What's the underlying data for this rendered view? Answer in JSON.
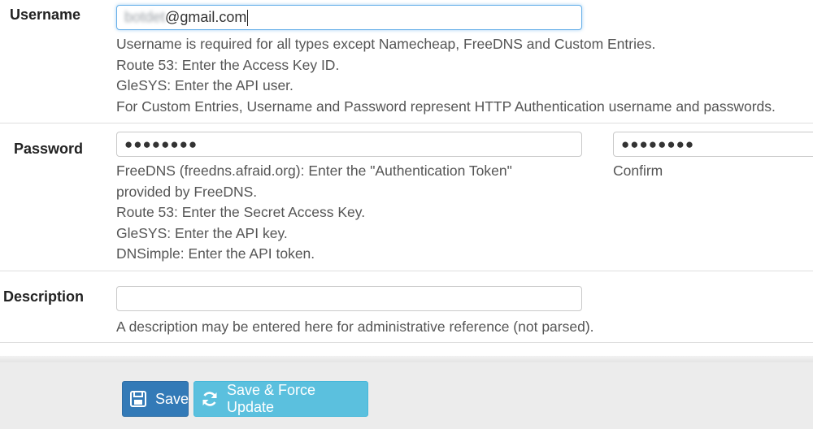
{
  "username": {
    "label": "Username",
    "value_blurred": "botdet",
    "value_suffix": "@gmail.com",
    "help": [
      "Username is required for all types except Namecheap, FreeDNS and Custom Entries.",
      "Route 53: Enter the Access Key ID.",
      "GleSYS: Enter the API user.",
      "For Custom Entries, Username and Password represent HTTP Authentication username and passwords."
    ]
  },
  "password": {
    "label": "Password",
    "value_mask": "●●●●●●●●",
    "confirm_mask": "●●●●●●●●",
    "confirm_label": "Confirm",
    "help": [
      "FreeDNS (freedns.afraid.org): Enter the \"Authentication Token\"",
      "provided by FreeDNS.",
      "Route 53: Enter the Secret Access Key.",
      "GleSYS: Enter the API key.",
      "DNSimple: Enter the API token."
    ]
  },
  "description": {
    "label": "Description",
    "value": "",
    "help": "A description may be entered here for administrative reference (not parsed)."
  },
  "buttons": {
    "save_label": "Save",
    "force_update_label": "Save & Force Update"
  },
  "colors": {
    "primary": "#337ab7",
    "info": "#5bc0de",
    "focus_border": "#66afe9"
  }
}
